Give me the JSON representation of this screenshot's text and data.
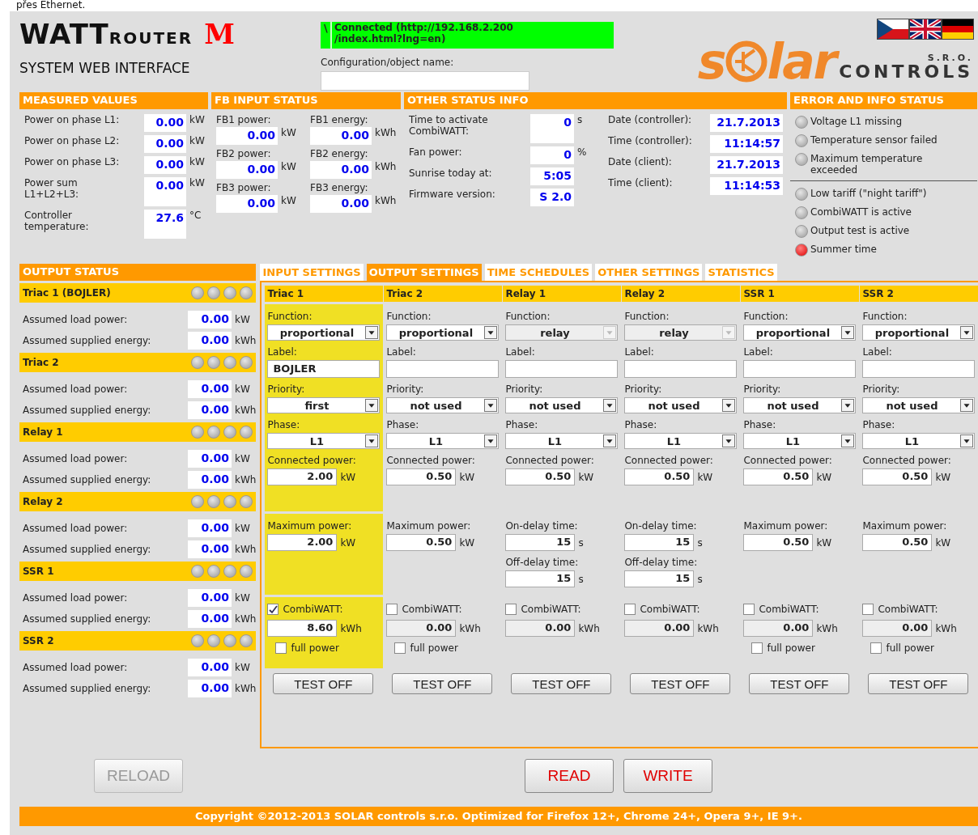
{
  "top_note": "přes Ethernet.",
  "header": {
    "brand_main": "WATT",
    "brand_sub": "ROUTER",
    "brand_mark": "M",
    "subtitle": "SYSTEM WEB INTERFACE",
    "connection": {
      "spinner": "\\",
      "text": "Connected (http://192.168.2.200\n/index.html?lng=en)"
    },
    "config_label": "Configuration/object name:",
    "logo": {
      "word_start": "s",
      "word_end": "lar",
      "company": "CONTROLS",
      "suffix": "S.R.O."
    },
    "languages": [
      {
        "kind": "cz"
      },
      {
        "kind": "gb"
      },
      {
        "kind": "de"
      }
    ]
  },
  "measured": {
    "title": "MEASURED VALUES",
    "rows": [
      {
        "label": "Power on phase L1:",
        "value": "0.00",
        "unit": "kW"
      },
      {
        "label": "Power on phase L2:",
        "value": "0.00",
        "unit": "kW"
      },
      {
        "label": "Power on phase L3:",
        "value": "0.00",
        "unit": "kW"
      },
      {
        "label": "Power sum\nL1+L2+L3:",
        "value": "0.00",
        "unit": "kW"
      },
      {
        "label": "Controller\ntemperature:",
        "value": "27.6",
        "unit": "°C"
      }
    ]
  },
  "fb_input": {
    "title": "FB INPUT STATUS",
    "items": [
      {
        "label": "FB1 power:",
        "value": "0.00",
        "unit": "kW"
      },
      {
        "label": "FB1 energy:",
        "value": "0.00",
        "unit": "kWh"
      },
      {
        "label": "FB2 power:",
        "value": "0.00",
        "unit": "kW"
      },
      {
        "label": "FB2 energy:",
        "value": "0.00",
        "unit": "kWh"
      },
      {
        "label": "FB3 power:",
        "value": "0.00",
        "unit": "kW"
      },
      {
        "label": "FB3 energy:",
        "value": "0.00",
        "unit": "kWh"
      }
    ]
  },
  "other_status": {
    "title": "OTHER STATUS INFO",
    "left": [
      {
        "label": "Time to activate\nCombiWATT:",
        "value": "0",
        "unit": "s"
      },
      {
        "label": "Fan power:",
        "value": "0",
        "unit": "%"
      },
      {
        "label": "Sunrise today at:",
        "value": "5:05"
      },
      {
        "label": "Firmware version:",
        "value": "S 2.0"
      }
    ],
    "right": [
      {
        "label": "Date (controller):",
        "value": "21.7.2013"
      },
      {
        "label": "Time (controller):",
        "value": "11:14:57"
      },
      {
        "label": "Date (client):",
        "value": "21.7.2013"
      },
      {
        "label": "Time (client):",
        "value": "11:14:53"
      }
    ]
  },
  "error_status": {
    "title": "ERROR AND INFO STATUS",
    "groups": [
      [
        {
          "label": "Voltage L1 missing",
          "on": false
        },
        {
          "label": "Temperature sensor failed",
          "on": false
        },
        {
          "label": "Maximum temperature\nexceeded",
          "on": false
        }
      ],
      [
        {
          "label": "Low tariff (\"night tariff\")",
          "on": false
        },
        {
          "label": "CombiWATT is active",
          "on": false
        },
        {
          "label": "Output test is active",
          "on": false
        },
        {
          "label": "Summer time",
          "on": true
        }
      ]
    ]
  },
  "output_status": {
    "title": "OUTPUT STATUS",
    "outputs": [
      {
        "name": "Triac 1 (BOJLER)",
        "leds": [
          {
            "on": false
          },
          {
            "on": false
          },
          {
            "on": false
          },
          {
            "on": false
          }
        ],
        "rows": [
          {
            "label": "Assumed load power:",
            "value": "0.00",
            "unit": "kW"
          },
          {
            "label": "Assumed supplied energy:",
            "value": "0.00",
            "unit": "kWh"
          }
        ]
      },
      {
        "name": "Triac 2",
        "leds": [
          {
            "on": false
          },
          {
            "on": false
          },
          {
            "on": false
          },
          {
            "on": false
          }
        ],
        "rows": [
          {
            "label": "Assumed load power:",
            "value": "0.00",
            "unit": "kW"
          },
          {
            "label": "Assumed supplied energy:",
            "value": "0.00",
            "unit": "kWh"
          }
        ]
      },
      {
        "name": "Relay 1",
        "leds": [
          {
            "on": false
          },
          {
            "on": false
          },
          {
            "on": false
          },
          {
            "on": false
          }
        ],
        "rows": [
          {
            "label": "Assumed load power:",
            "value": "0.00",
            "unit": "kW"
          },
          {
            "label": "Assumed supplied energy:",
            "value": "0.00",
            "unit": "kWh"
          }
        ]
      },
      {
        "name": "Relay 2",
        "leds": [
          {
            "on": false
          },
          {
            "on": false
          },
          {
            "on": false
          },
          {
            "on": false
          }
        ],
        "rows": [
          {
            "label": "Assumed load power:",
            "value": "0.00",
            "unit": "kW"
          },
          {
            "label": "Assumed supplied energy:",
            "value": "0.00",
            "unit": "kWh"
          }
        ]
      },
      {
        "name": "SSR 1",
        "leds": [
          {
            "on": false
          },
          {
            "on": false
          },
          {
            "on": false
          },
          {
            "on": false
          }
        ],
        "rows": [
          {
            "label": "Assumed load power:",
            "value": "0.00",
            "unit": "kW"
          },
          {
            "label": "Assumed supplied energy:",
            "value": "0.00",
            "unit": "kWh"
          }
        ]
      },
      {
        "name": "SSR 2",
        "leds": [
          {
            "on": false
          },
          {
            "on": false
          },
          {
            "on": false
          },
          {
            "on": false
          }
        ],
        "rows": [
          {
            "label": "Assumed load power:",
            "value": "0.00",
            "unit": "kW"
          },
          {
            "label": "Assumed supplied energy:",
            "value": "0.00",
            "unit": "kWh"
          }
        ]
      }
    ]
  },
  "tabs": [
    {
      "label": "INPUT SETTINGS",
      "selected": false
    },
    {
      "label": "OUTPUT SETTINGS",
      "selected": true
    },
    {
      "label": "TIME SCHEDULES",
      "selected": false
    },
    {
      "label": "OTHER SETTINGS",
      "selected": false
    },
    {
      "label": "STATISTICS",
      "selected": false
    }
  ],
  "output_settings": [
    {
      "name": "Triac 1",
      "highlighted": true,
      "function": {
        "label": "Function:",
        "value": "proportional",
        "disabled": false
      },
      "label_field": {
        "label": "Label:",
        "value": "BOJLER"
      },
      "priority": {
        "label": "Priority:",
        "value": "first"
      },
      "phase": {
        "label": "Phase:",
        "value": "L1"
      },
      "connected_power": {
        "label": "Connected power:",
        "value": "2.00",
        "unit": "kW"
      },
      "limits": [
        {
          "label": "Maximum power:",
          "value": "2.00",
          "unit": "kW"
        }
      ],
      "combiwatt": {
        "label": "CombiWATT:",
        "checked": true,
        "value": "8.60",
        "unit": "kWh"
      },
      "full_power": {
        "label": "full power",
        "checked": false
      },
      "test_button": "TEST OFF"
    },
    {
      "name": "Triac 2",
      "highlighted": false,
      "function": {
        "label": "Function:",
        "value": "proportional",
        "disabled": false
      },
      "label_field": {
        "label": "Label:"
      },
      "priority": {
        "label": "Priority:",
        "value": "not used"
      },
      "phase": {
        "label": "Phase:",
        "value": "L1"
      },
      "connected_power": {
        "label": "Connected power:",
        "value": "0.50",
        "unit": "kW"
      },
      "limits": [
        {
          "label": "Maximum power:",
          "value": "0.50",
          "unit": "kW"
        }
      ],
      "combiwatt": {
        "label": "CombiWATT:",
        "checked": false,
        "value": "0.00",
        "unit": "kWh"
      },
      "full_power": {
        "label": "full power",
        "checked": false
      },
      "test_button": "TEST OFF"
    },
    {
      "name": "Relay 1",
      "highlighted": false,
      "function": {
        "label": "Function:",
        "value": "relay",
        "disabled": true
      },
      "label_field": {
        "label": "Label:"
      },
      "priority": {
        "label": "Priority:",
        "value": "not used"
      },
      "phase": {
        "label": "Phase:",
        "value": "L1"
      },
      "connected_power": {
        "label": "Connected power:",
        "value": "0.50",
        "unit": "kW"
      },
      "limits": [
        {
          "label": "On-delay time:",
          "value": "15",
          "unit": "s"
        },
        {
          "label": "Off-delay time:",
          "value": "15",
          "unit": "s"
        }
      ],
      "combiwatt": {
        "label": "CombiWATT:",
        "checked": false,
        "value": "0.00",
        "unit": "kWh"
      },
      "test_button": "TEST OFF"
    },
    {
      "name": "Relay 2",
      "highlighted": false,
      "function": {
        "label": "Function:",
        "value": "relay",
        "disabled": true
      },
      "label_field": {
        "label": "Label:"
      },
      "priority": {
        "label": "Priority:",
        "value": "not used"
      },
      "phase": {
        "label": "Phase:",
        "value": "L1"
      },
      "connected_power": {
        "label": "Connected power:",
        "value": "0.50",
        "unit": "kW"
      },
      "limits": [
        {
          "label": "On-delay time:",
          "value": "15",
          "unit": "s"
        },
        {
          "label": "Off-delay time:",
          "value": "15",
          "unit": "s"
        }
      ],
      "combiwatt": {
        "label": "CombiWATT:",
        "checked": false,
        "value": "0.00",
        "unit": "kWh"
      },
      "test_button": "TEST OFF"
    },
    {
      "name": "SSR 1",
      "highlighted": false,
      "function": {
        "label": "Function:",
        "value": "proportional",
        "disabled": false
      },
      "label_field": {
        "label": "Label:"
      },
      "priority": {
        "label": "Priority:",
        "value": "not used"
      },
      "phase": {
        "label": "Phase:",
        "value": "L1"
      },
      "connected_power": {
        "label": "Connected power:",
        "value": "0.50",
        "unit": "kW"
      },
      "limits": [
        {
          "label": "Maximum power:",
          "value": "0.50",
          "unit": "kW"
        }
      ],
      "combiwatt": {
        "label": "CombiWATT:",
        "checked": false,
        "value": "0.00",
        "unit": "kWh"
      },
      "full_power": {
        "label": "full power",
        "checked": false
      },
      "test_button": "TEST OFF"
    },
    {
      "name": "SSR 2",
      "highlighted": false,
      "function": {
        "label": "Function:",
        "value": "proportional",
        "disabled": false
      },
      "label_field": {
        "label": "Label:"
      },
      "priority": {
        "label": "Priority:",
        "value": "not used"
      },
      "phase": {
        "label": "Phase:",
        "value": "L1"
      },
      "connected_power": {
        "label": "Connected power:",
        "value": "0.50",
        "unit": "kW"
      },
      "limits": [
        {
          "label": "Maximum power:",
          "value": "0.50",
          "unit": "kW"
        }
      ],
      "combiwatt": {
        "label": "CombiWATT:",
        "checked": false,
        "value": "0.00",
        "unit": "kWh"
      },
      "full_power": {
        "label": "full power",
        "checked": false
      },
      "test_button": "TEST OFF"
    }
  ],
  "actions": [
    {
      "label": "RELOAD",
      "disabled": true
    },
    {
      "label": "READ",
      "disabled": false
    },
    {
      "label": "WRITE",
      "disabled": false
    }
  ],
  "footer": "Copyright ©2012-2013 SOLAR controls s.r.o. Optimized for Firefox 12+, Chrome 24+, Opera 9+, IE 9+."
}
